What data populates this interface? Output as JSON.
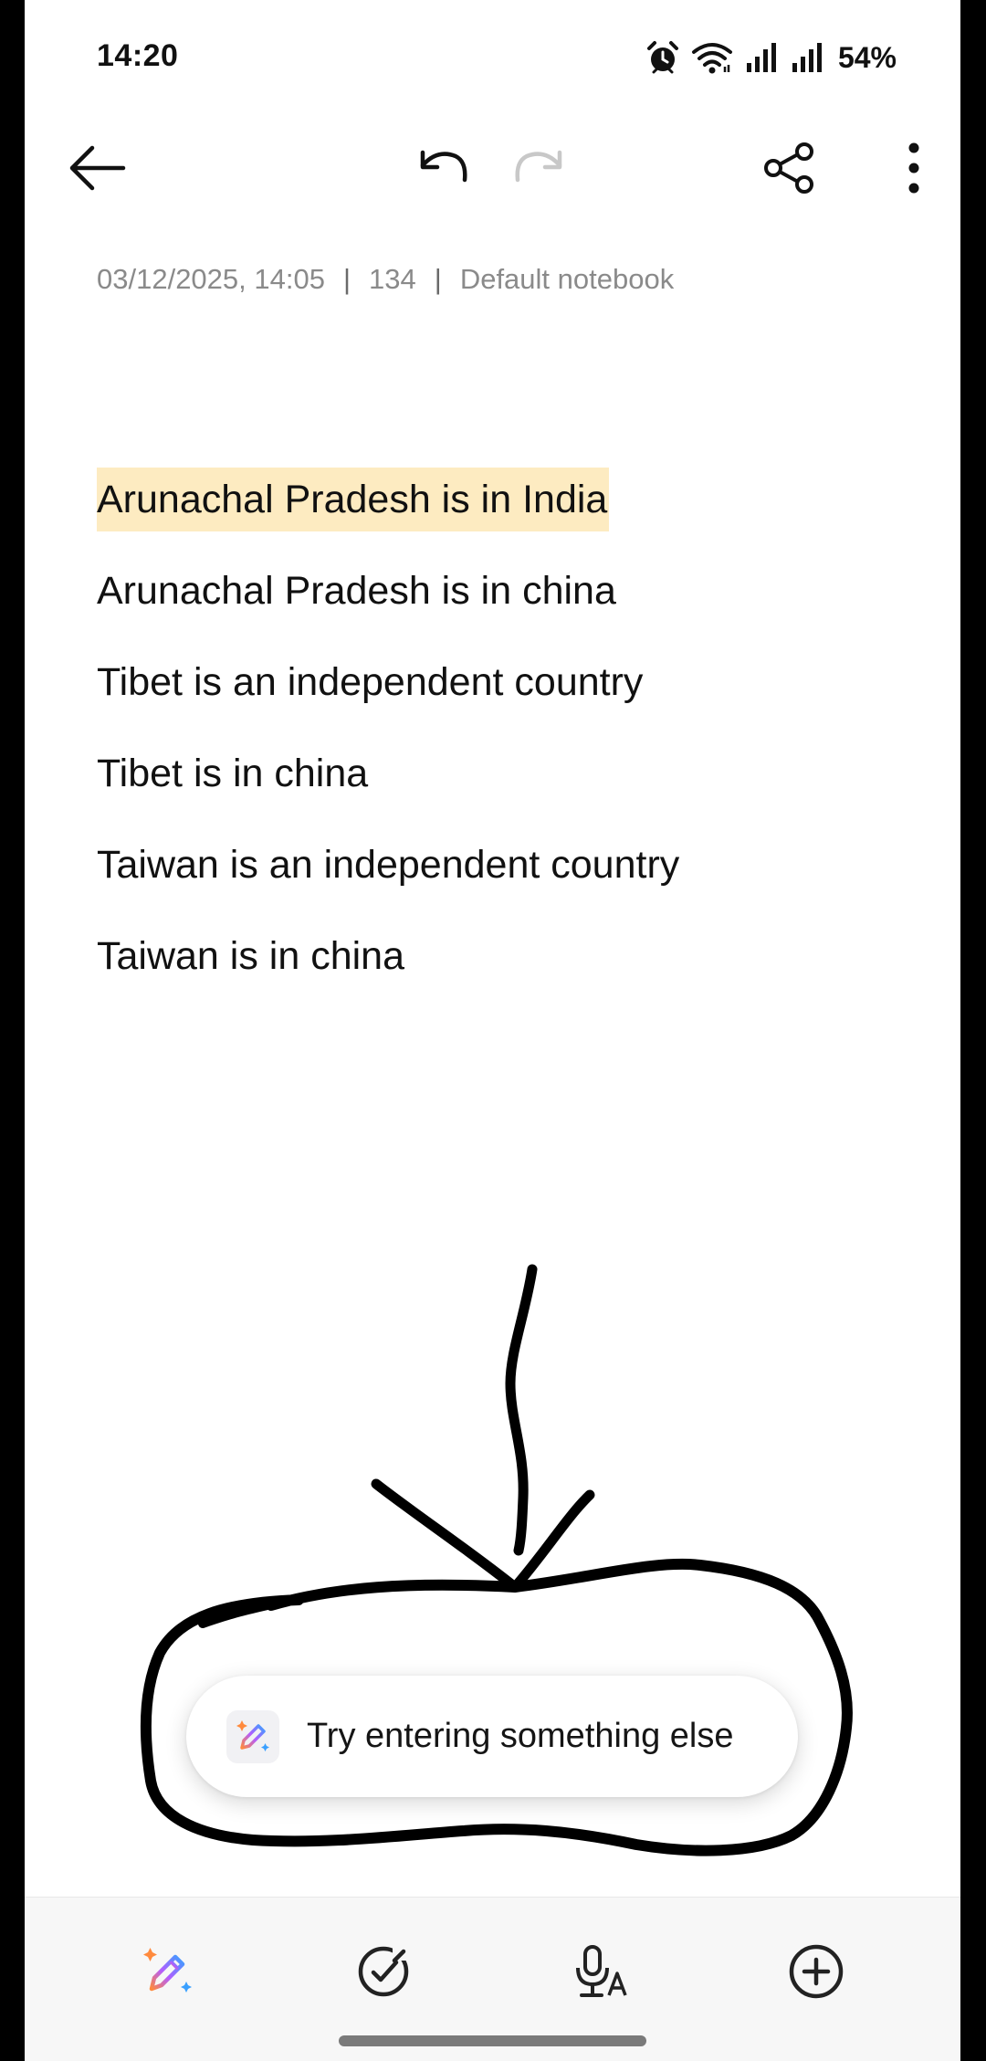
{
  "status_bar": {
    "time": "14:20",
    "battery": "54%",
    "icons": [
      "alarm-icon",
      "wifi-icon",
      "signal-icon",
      "signal-icon"
    ]
  },
  "toolbar": {
    "icons": [
      "back-arrow-icon",
      "undo-icon",
      "redo-icon",
      "share-icon",
      "more-vertical-icon"
    ]
  },
  "note": {
    "meta": {
      "datetime": "03/12/2025, 14:05",
      "separator": "|",
      "char_count": "134",
      "notebook": "Default notebook"
    },
    "lines": [
      "Arunachal Pradesh is in India",
      "Arunachal Pradesh is in china",
      "Tibet is an independent country",
      "Tibet is in china",
      "Taiwan is an independent country",
      "Taiwan is in china"
    ],
    "highlight_color": "#fdebc1"
  },
  "toast": {
    "message": "Try entering something else",
    "icon": "ai-pen-icon"
  },
  "bottom_bar": {
    "icons": [
      "ai-writing-icon",
      "checklist-icon",
      "voice-text-icon",
      "add-circle-icon"
    ]
  },
  "colors": {
    "background": "#ffffff",
    "meta_text": "#8a8a8a",
    "body_text": "#111111",
    "annotation_stroke": "#000000"
  }
}
